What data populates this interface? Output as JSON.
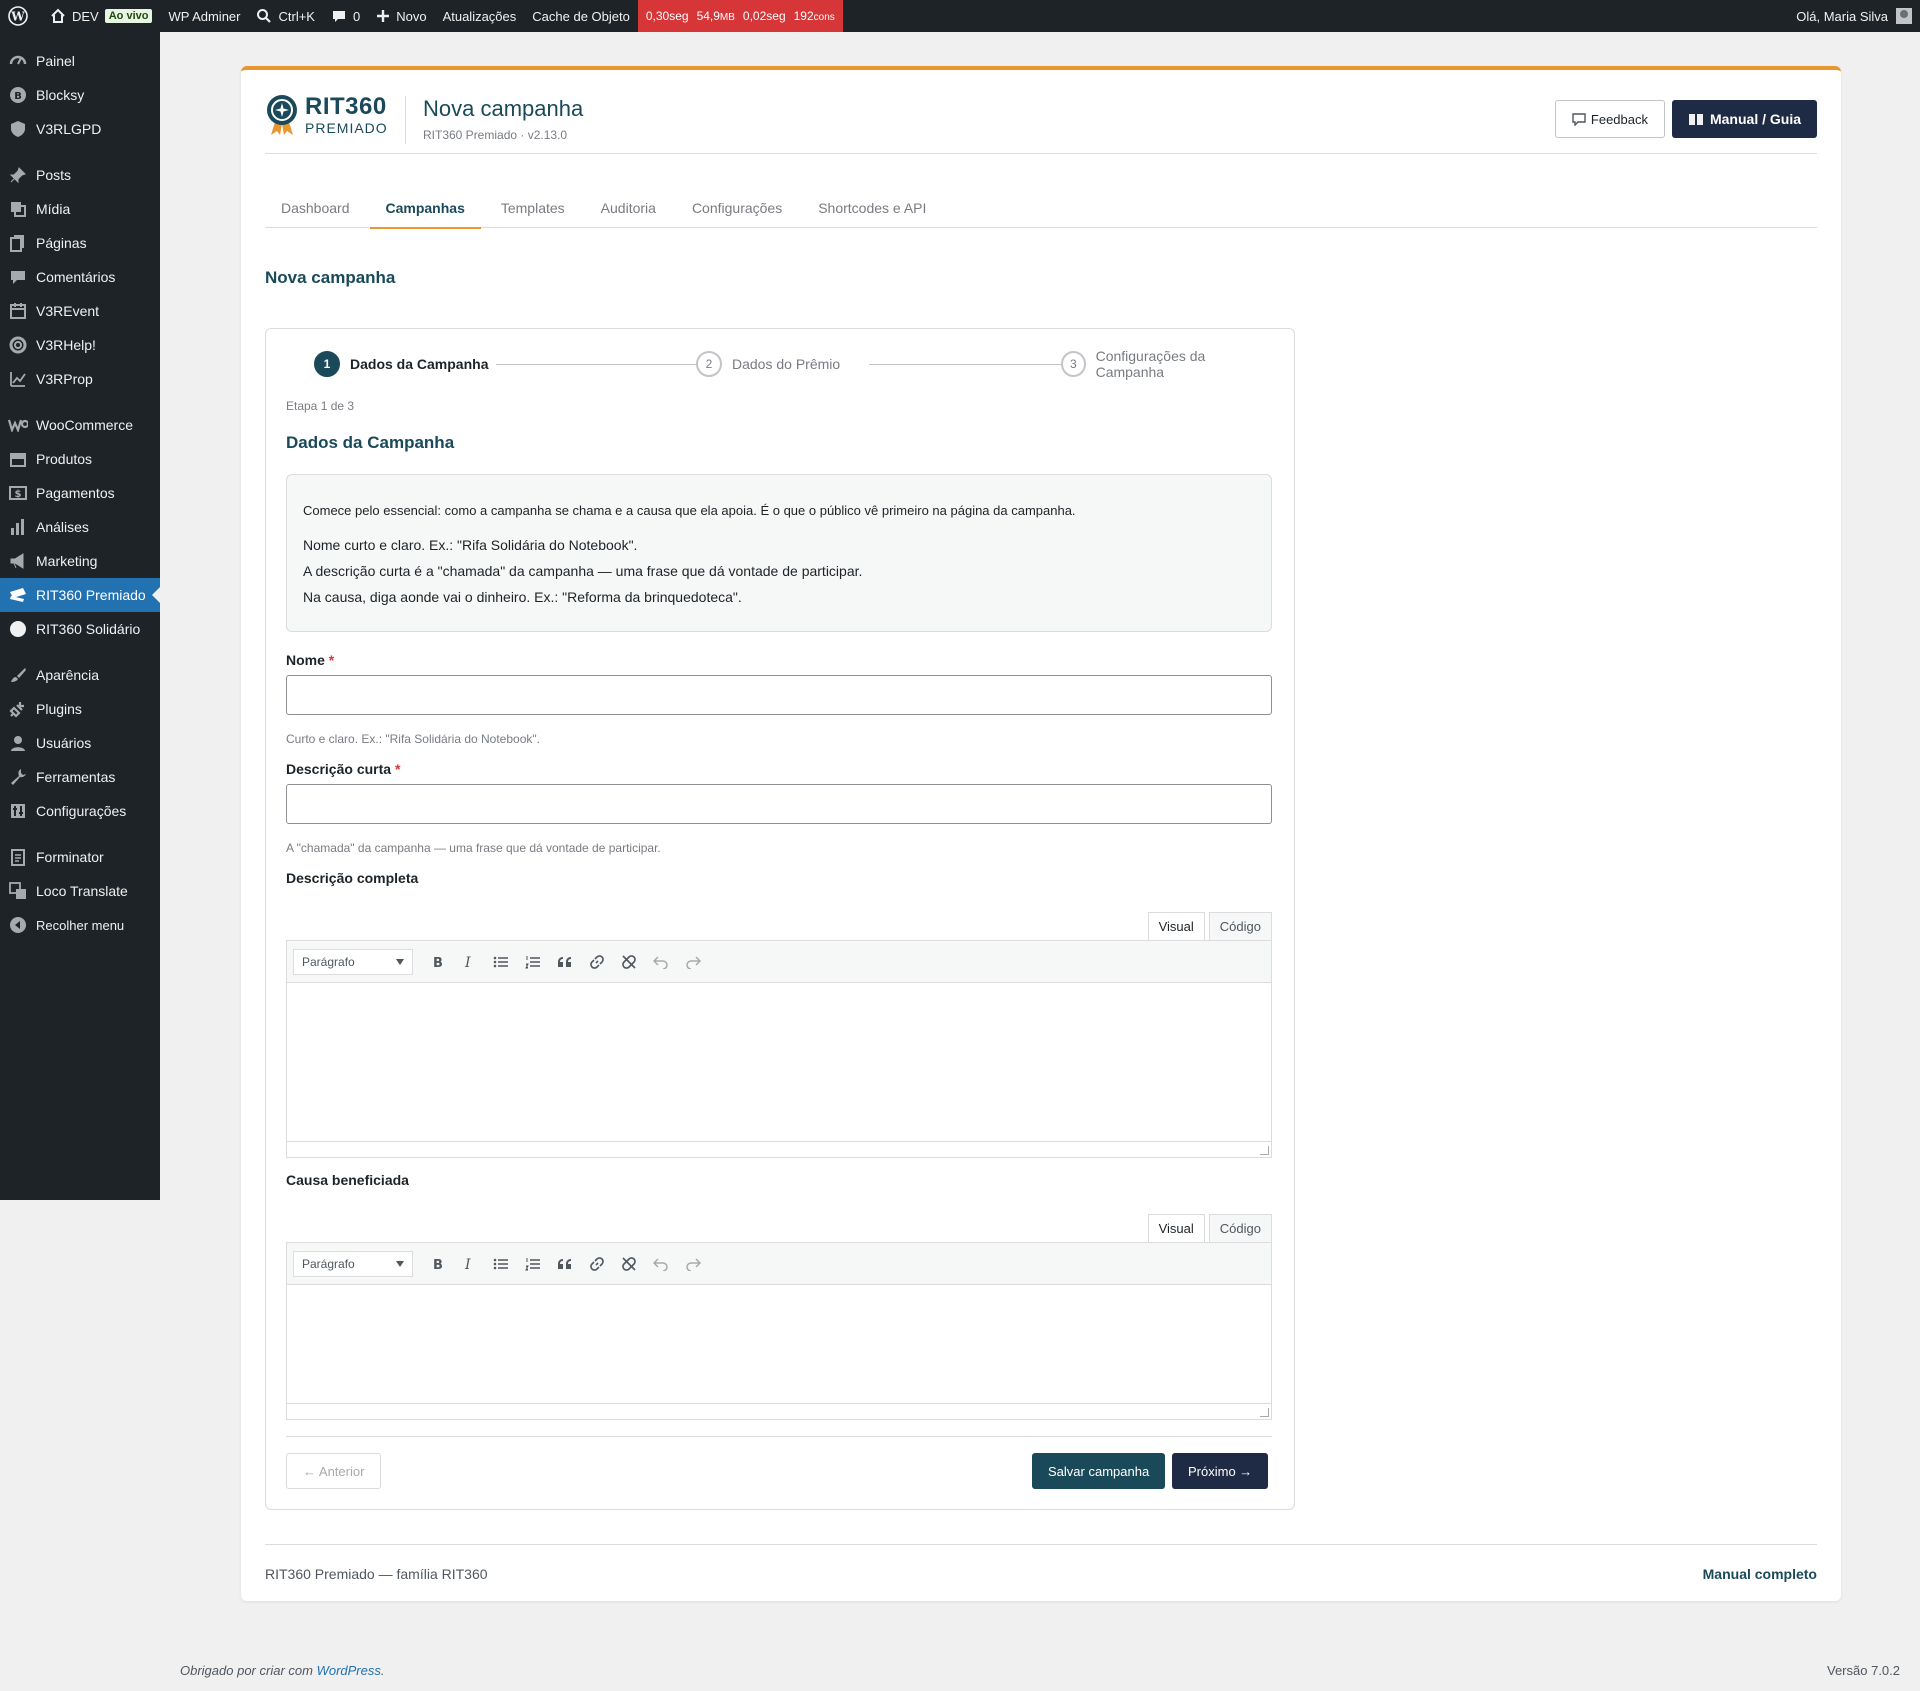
{
  "adminbar": {
    "site": "DEV",
    "live": "Ao vivo",
    "adminer": "WP Adminer",
    "search_shortcut": "Ctrl+K",
    "comments_count": "0",
    "new": "Novo",
    "updates": "Atualizações",
    "object_cache": "Cache de Objeto",
    "perf_time": "0,30seg",
    "perf_mem": "54,9",
    "perf_mem_unit": "MB",
    "perf_query": "0,02seg",
    "perf_cons": "192",
    "perf_cons_unit": "cons",
    "greeting": "Olá, Maria Silva",
    "colors": {
      "bg": "#1d2327",
      "perf": "#d63638"
    }
  },
  "sidebar": {
    "items": [
      {
        "label": "Painel",
        "icon": "dashboard-icon"
      },
      {
        "label": "Blocksy",
        "icon": "blocksy-icon"
      },
      {
        "label": "V3RLGPD",
        "icon": "shield-icon"
      },
      {
        "label": "Posts",
        "icon": "pin-icon"
      },
      {
        "label": "Mídia",
        "icon": "media-icon"
      },
      {
        "label": "Páginas",
        "icon": "pages-icon"
      },
      {
        "label": "Comentários",
        "icon": "comment-icon"
      },
      {
        "label": "V3REvent",
        "icon": "calendar-icon"
      },
      {
        "label": "V3RHelp!",
        "icon": "help-icon"
      },
      {
        "label": "V3RProp",
        "icon": "chart-icon"
      },
      {
        "label": "WooCommerce",
        "icon": "woo-icon"
      },
      {
        "label": "Produtos",
        "icon": "archive-icon"
      },
      {
        "label": "Pagamentos",
        "icon": "money-icon"
      },
      {
        "label": "Análises",
        "icon": "bar-chart-icon"
      },
      {
        "label": "Marketing",
        "icon": "megaphone-icon"
      },
      {
        "label": "RIT360 Premiado",
        "icon": "ticket-icon"
      },
      {
        "label": "RIT360 Solidário",
        "icon": "circle-icon"
      },
      {
        "label": "Aparência",
        "icon": "brush-icon"
      },
      {
        "label": "Plugins",
        "icon": "plug-icon"
      },
      {
        "label": "Usuários",
        "icon": "user-icon"
      },
      {
        "label": "Ferramentas",
        "icon": "wrench-icon"
      },
      {
        "label": "Configurações",
        "icon": "settings-icon"
      },
      {
        "label": "Forminator",
        "icon": "form-icon"
      },
      {
        "label": "Loco Translate",
        "icon": "translate-icon"
      },
      {
        "label": "Recolher menu",
        "icon": "collapse-icon"
      }
    ],
    "active": "RIT360 Premiado"
  },
  "header": {
    "logo_brand": "RIT360",
    "logo_sub": "PREMIADO",
    "title": "Nova campanha",
    "version": "RIT360 Premiado · v2.13.0",
    "feedback": "Feedback",
    "manual": "Manual / Guia",
    "accent": "#e8972f",
    "brand_color": "#1a4a5a"
  },
  "tabs": [
    {
      "label": "Dashboard",
      "active": false
    },
    {
      "label": "Campanhas",
      "active": true
    },
    {
      "label": "Templates",
      "active": false
    },
    {
      "label": "Auditoria",
      "active": false
    },
    {
      "label": "Configurações",
      "active": false
    },
    {
      "label": "Shortcodes e API",
      "active": false
    }
  ],
  "page_heading": "Nova campanha",
  "wizard": {
    "steps": [
      {
        "num": "1",
        "label": "Dados da Campanha",
        "active": true
      },
      {
        "num": "2",
        "label": "Dados do Prêmio",
        "active": false
      },
      {
        "num": "3",
        "label": "Configurações da Campanha",
        "active": false
      }
    ],
    "step_count": "Etapa 1 de 3",
    "heading": "Dados da Campanha",
    "intro": {
      "lead": "Comece pelo essencial: como a campanha se chama e a causa que ela apoia. É o que o público vê primeiro na página da campanha.",
      "tips": [
        "Nome curto e claro. Ex.: \"Rifa Solidária do Notebook\".",
        "A descrição curta é a \"chamada\" da campanha — uma frase que dá vontade de participar.",
        "Na causa, diga aonde vai o dinheiro. Ex.: \"Reforma da brinquedoteca\"."
      ]
    },
    "fields": {
      "name_label": "Nome",
      "name_value": "",
      "name_help": "Curto e claro. Ex.: \"Rifa Solidária do Notebook\".",
      "short_label": "Descrição curta",
      "short_value": "",
      "short_help": "A \"chamada\" da campanha — uma frase que dá vontade de participar.",
      "full_label": "Descrição completa",
      "cause_label": "Causa beneficiada",
      "required_mark": "*"
    },
    "editor": {
      "tab_visual": "Visual",
      "tab_code": "Código",
      "format": "Parágrafo"
    },
    "buttons": {
      "prev": "← Anterior",
      "save": "Salvar campanha",
      "next": "Próximo →"
    }
  },
  "card_footer": {
    "left": "RIT360 Premiado — família RIT360",
    "right": "Manual completo"
  },
  "wp_footer": {
    "thanks": "Obrigado por criar com",
    "wordpress": "WordPress",
    "period": ".",
    "version": "Versão 7.0.2"
  }
}
